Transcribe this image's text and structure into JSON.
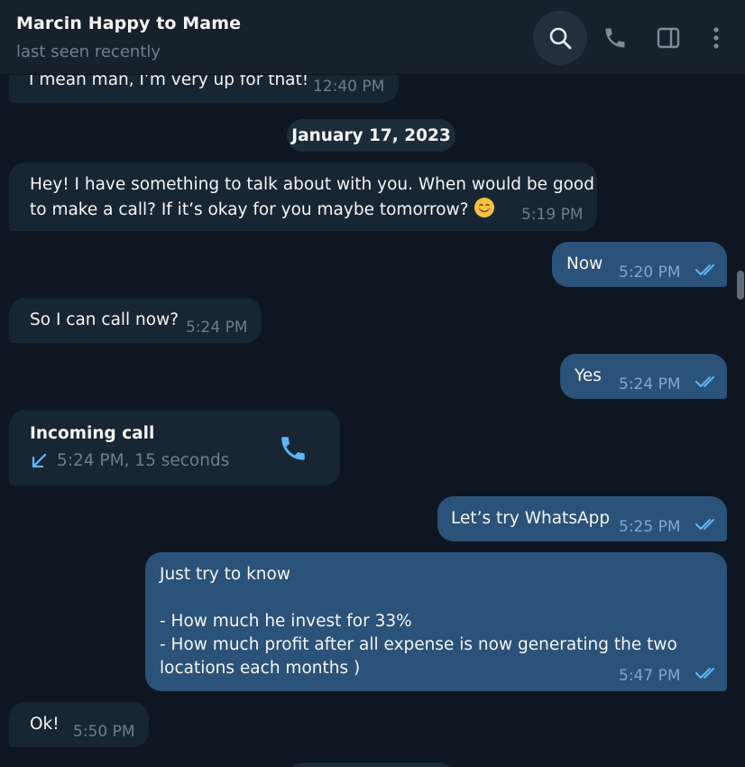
{
  "header": {
    "contact_name": "Marcin Happy to Mame",
    "status": "last seen recently",
    "icons": [
      "search-icon",
      "phone-icon",
      "side-panel-icon",
      "more-icon"
    ]
  },
  "colors": {
    "background": "#0e1621",
    "header": "#17212b",
    "incoming_bubble": "#182533",
    "outgoing_bubble": "#2b5278",
    "accent": "#5eb5f7",
    "muted_text": "#6d7f8f"
  },
  "messages": {
    "m0": {
      "text": "I mean man, I’m very up for that!",
      "time": "12:40 PM"
    },
    "date_separator": "January 17, 2023",
    "m1": {
      "line1": "Hey! I have something to talk about with you. When would be good",
      "line2": "to make a call? If it’s okay for you maybe tomorrow?",
      "emoji": "😊",
      "time": "5:19 PM"
    },
    "m2": {
      "text": "Now",
      "time": "5:20 PM",
      "status": "read"
    },
    "m3": {
      "text": "So I can call now?",
      "time": "5:24 PM"
    },
    "m4": {
      "text": "Yes",
      "time": "5:24 PM",
      "status": "read"
    },
    "call": {
      "title": "Incoming call",
      "detail": "5:24 PM, 15 seconds",
      "icon": "phone-icon"
    },
    "m5": {
      "text": "Let’s try WhatsApp",
      "time": "5:25 PM",
      "status": "read"
    },
    "m6": {
      "line1": "Just try to know",
      "line2": "- How much he invest for 33%",
      "line3": "- How much profit after all expense is now generating the two",
      "line4": "locations each months )",
      "time": "5:47 PM",
      "status": "read"
    },
    "m7": {
      "text": "Ok!",
      "time": "5:50 PM"
    }
  }
}
